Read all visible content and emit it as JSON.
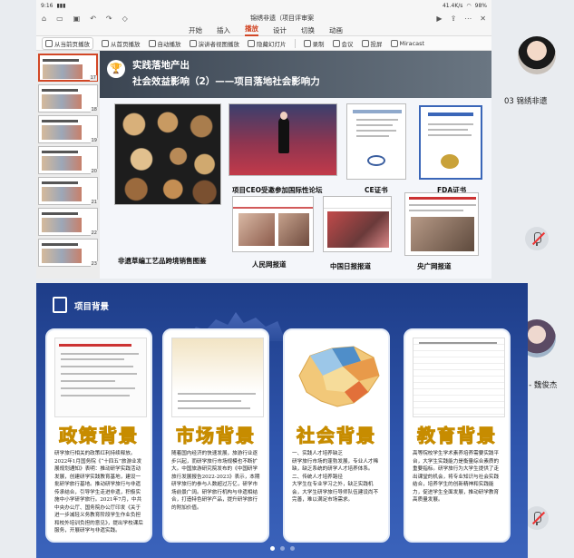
{
  "status_bar": {
    "time": "9:16",
    "battery": "41.4K/s",
    "battery_pct": "98%"
  },
  "quick_access": {
    "title": "锦绣非遗（项目评审案"
  },
  "menu": {
    "tabs": [
      "开始",
      "插入",
      "播放",
      "设计",
      "切换",
      "动画"
    ],
    "active_index": 2
  },
  "ribbon": {
    "buttons": [
      "从当前页播放",
      "从首页播放",
      "自动播放",
      "演讲者视图播放",
      "隐藏幻灯片",
      "录制",
      "会议",
      "投屏",
      "Miracast"
    ]
  },
  "thumbnails": {
    "numbers": [
      "17",
      "18",
      "19",
      "20",
      "21",
      "22",
      "23"
    ],
    "selected_index": 0
  },
  "slide": {
    "title_line1": "实践落地产出",
    "title_line2": "社会效益影响（2）——项目落地社会影响力",
    "captions": {
      "ceo": "项目CEO受邀参加国际性论坛",
      "ce": "CE证书",
      "fda": "FDA证书",
      "sales": "非遗草编工艺品跨境销售图鉴",
      "people": "人民网报道",
      "china_daily": "中国日报报道",
      "cctv": "央广网报道"
    }
  },
  "participants": [
    {
      "name": "03 锦绣非遗"
    },
    {
      "name": "1遇见 - 魏俊杰"
    }
  ],
  "bottom_slide": {
    "section_title": "项目背景",
    "cards": [
      {
        "heading": "政策背景",
        "body": "研学旅行相关的政策红利持续释放。2022年1月国务院《“十四五”旅游业发展规划通知》表明：推动研学实践活动发展，创建研学实践教育基地，建设一批研学旅行基地。推动研学旅行与非遗传承结合，引导学生走进非遗，积极实施中小学研学旅行。2021年7月，中共中央办公厅、国务院办公厅印发《关于进一步减轻义务教育阶段学生作业负担和校外培训负担的意见》，提出学校课后服务，开展研学与非遗实践。"
      },
      {
        "heading": "市场背景",
        "body": "随着国内经济的快速发展，旅游行业逐步兴起，而研学旅行市场规模也不断扩大。中国旅游研究院发布的《中国研学旅行发展报告2022-2023》表示，本期研学旅行的参与人数超过万亿，研学市场前景广阔。研学旅行机构与非遗相结合，打造特色研学产品，提升研学旅行的附加价值。"
      },
      {
        "heading": "社会背景",
        "body": "一、实践人才培养缺乏\n研学旅行市场的蓬勃发展，专业人才稀缺，缺乏系统的研学人才培养体系。\n二、传统人才培养路径\n大学生在专业学习之外，缺乏实践机会，大学生研学旅行导师队伍建设尚不完善，难以满足市场需求。"
      },
      {
        "heading": "教育背景",
        "body": "高等院校学生学术素养培养需要实践平台，大学生实践能力是衡量综合素质的重要指标。研学旅行为大学生提供了走出课堂的机会，将专业知识与社会实践结合，培养学生的创新精神和实践能力，促进学生全面发展，推动研学教育高质量发展。"
      }
    ],
    "page_dots": 3,
    "active_dot": 0
  }
}
